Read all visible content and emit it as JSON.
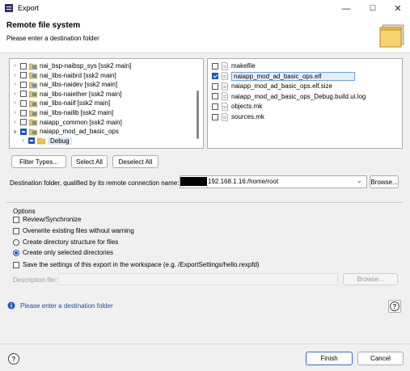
{
  "window": {
    "title": "Export",
    "minimize": "—",
    "maximize": "☐",
    "close": "✕"
  },
  "banner": {
    "title": "Remote file system",
    "message": "Please enter a destination folder"
  },
  "left_tree": [
    {
      "label": "nai_bsp-naibsp_sys [ssk2 main]",
      "expanded": false,
      "check": "none",
      "kind": "project"
    },
    {
      "label": "nai_libs-naibrd [ssk2 main]",
      "expanded": false,
      "check": "none",
      "kind": "project"
    },
    {
      "label": "nai_libs-naidev [ssk2 main]",
      "expanded": false,
      "check": "none",
      "kind": "project"
    },
    {
      "label": "nai_libs-naiether [ssk2 main]",
      "expanded": false,
      "check": "none",
      "kind": "project"
    },
    {
      "label": "nai_libs-naiif [ssk2 main]",
      "expanded": false,
      "check": "none",
      "kind": "project"
    },
    {
      "label": "nai_libs-nailib [ssk2 main]",
      "expanded": false,
      "check": "none",
      "kind": "project"
    },
    {
      "label": "naiapp_common [ssk2 main]",
      "expanded": false,
      "check": "none",
      "kind": "project"
    },
    {
      "label": "naiapp_mod_ad_basic_ops",
      "expanded": true,
      "check": "partial",
      "kind": "project"
    },
    {
      "label": "Debug",
      "expanded": false,
      "check": "partial",
      "kind": "folder",
      "selected": true
    }
  ],
  "right_files": [
    {
      "label": "makefile",
      "checked": false
    },
    {
      "label": "naiapp_mod_ad_basic_ops.elf",
      "checked": true,
      "selected": true
    },
    {
      "label": "naiapp_mod_ad_basic_ops.elf.size",
      "checked": false
    },
    {
      "label": "naiapp_mod_ad_basic_ops_Debug.build.ui.log",
      "checked": false
    },
    {
      "label": "objects.mk",
      "checked": false
    },
    {
      "label": "sources.mk",
      "checked": false
    }
  ],
  "buttons": {
    "filter_types": "Filter Types...",
    "select_all": "Select All",
    "deselect_all": "Deselect All",
    "browse": "Browse...",
    "browse_desc": "Browse...",
    "finish": "Finish",
    "cancel": "Cancel"
  },
  "destination": {
    "label": "Destination folder, qualified by its remote connection name:",
    "value": "192.168.1.16:/home/root"
  },
  "options": {
    "title": "Options",
    "review_sync": {
      "label": "Review/Synchronize",
      "checked": false
    },
    "overwrite": {
      "label": "Overwrite existing files without warning",
      "checked": false
    },
    "create_structure": {
      "label": "Create directory structure for files",
      "selected": false
    },
    "create_selected": {
      "label": "Create only selected directories",
      "selected": true
    },
    "save_settings": {
      "label": "Save the settings of this export in the workspace (e.g. /ExportSettings/hello.rexpfd)",
      "checked": false
    },
    "description_label": "Description file:"
  },
  "status": {
    "message": "Please enter a destination folder"
  },
  "colors": {
    "accent": "#1a56c4",
    "link": "#1a4fa8"
  }
}
